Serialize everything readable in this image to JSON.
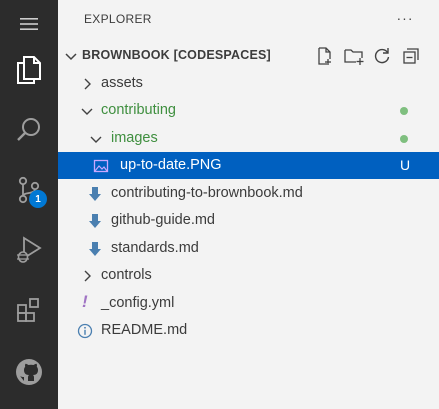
{
  "explorer": {
    "title": "EXPLORER",
    "more": "···"
  },
  "section": {
    "title": "BROWNBOOK [CODESPACES]"
  },
  "activity_bar": {
    "source_control_badge": "1"
  },
  "tree": {
    "items": [
      {
        "label": "assets",
        "type": "folder",
        "expanded": false
      },
      {
        "label": "contributing",
        "type": "folder",
        "expanded": true,
        "modified": true
      },
      {
        "label": "images",
        "type": "folder",
        "expanded": true,
        "modified": true
      },
      {
        "label": "up-to-date.PNG",
        "type": "image",
        "selected": true,
        "status": "U"
      },
      {
        "label": "contributing-to-brownbook.md",
        "type": "markdown"
      },
      {
        "label": "github-guide.md",
        "type": "markdown"
      },
      {
        "label": "standards.md",
        "type": "markdown"
      },
      {
        "label": "controls",
        "type": "folder",
        "expanded": false
      },
      {
        "label": "_config.yml",
        "type": "yaml",
        "icon_glyph": "!"
      },
      {
        "label": "README.md",
        "type": "info"
      }
    ]
  },
  "colors": {
    "activity_bar": "#2c2c2c",
    "sidebar": "#f3f3f3",
    "selection": "#0060c0",
    "badge": "#0078d4",
    "modified_folder_text": "#3f8f3f",
    "modified_dot": "#7fbf7f",
    "markdown_icon": "#4a7fb0",
    "yaml_icon": "#a074c4"
  }
}
